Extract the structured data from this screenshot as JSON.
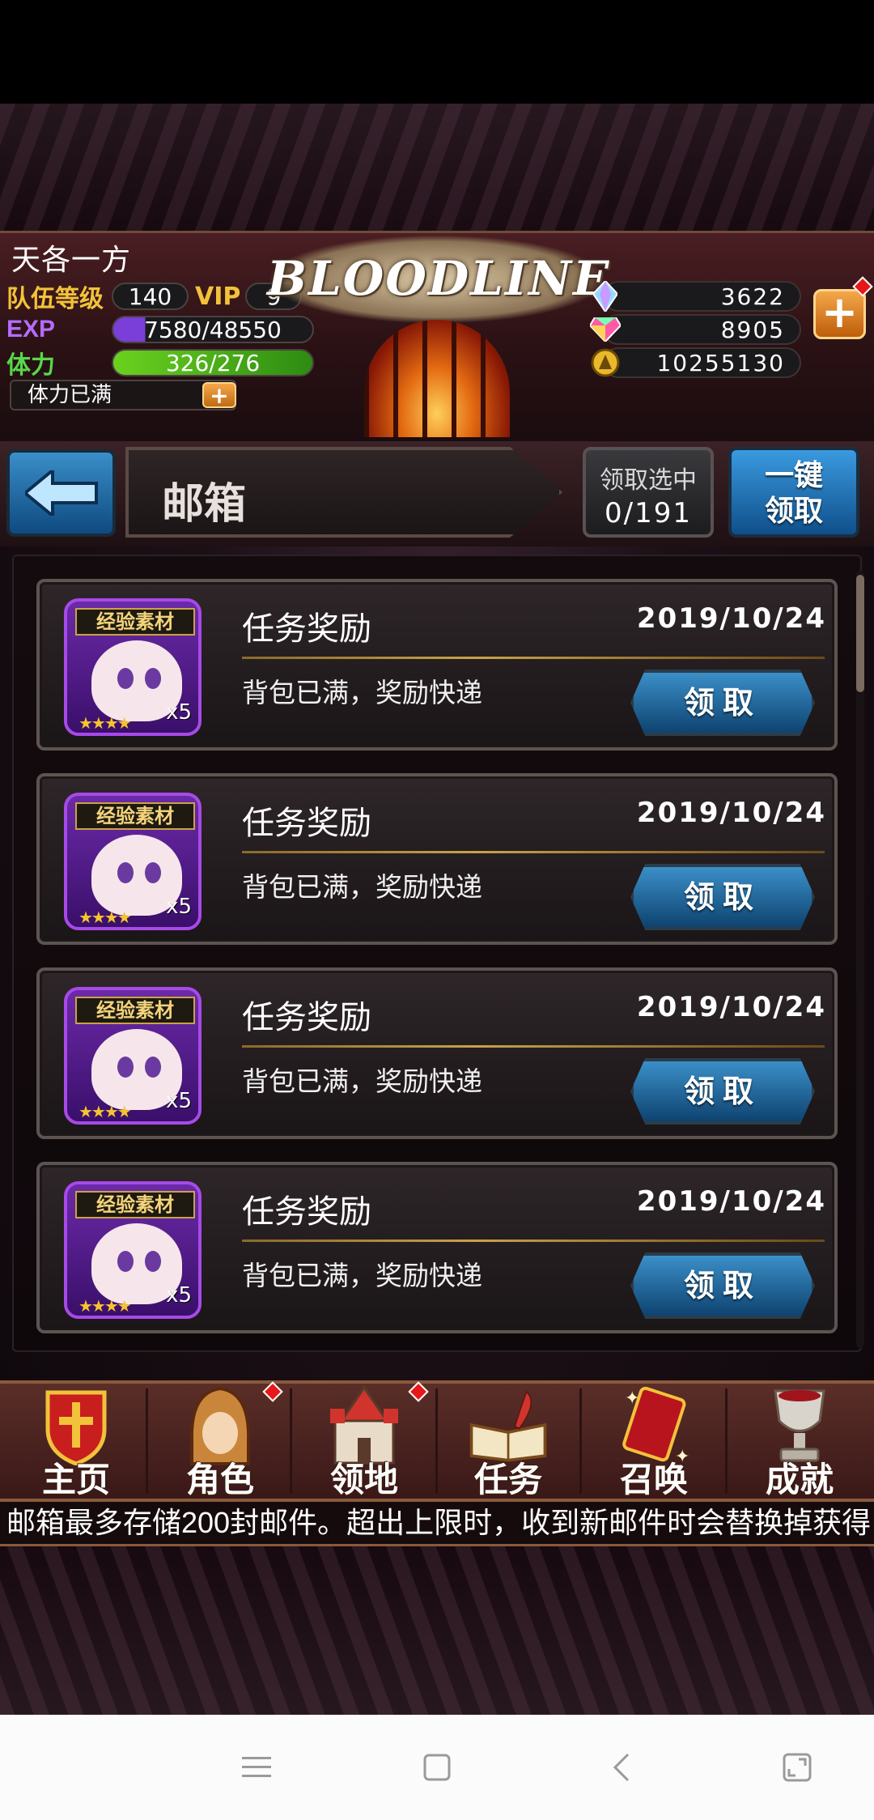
{
  "player": {
    "name": "天各一方",
    "level_label": "队伍等级",
    "level": "140",
    "vip_label": "VIP",
    "vip": "9",
    "exp_label": "EXP",
    "exp": "7580/48550",
    "exp_fraction": 0.156,
    "stamina_label": "体力",
    "stamina": "326/276",
    "stamina_full_text": "体力已满"
  },
  "logo": {
    "text": "BLOODLINE"
  },
  "currencies": [
    {
      "icon": "crystal-icon",
      "value": "3622"
    },
    {
      "icon": "gem-icon",
      "value": "8905"
    },
    {
      "icon": "gold-coin-icon",
      "value": "10255130"
    }
  ],
  "titlebar": {
    "title": "邮箱",
    "select_label": "领取选中",
    "select_count": "0/191",
    "claim_all": "一键领取"
  },
  "mails": [
    {
      "item_tag": "经验素材",
      "quantity": "x5",
      "stars": 4,
      "title": "任务奖励",
      "date": "2019/10/24",
      "description": "背包已满，奖励快递",
      "claim_label": "领取"
    },
    {
      "item_tag": "经验素材",
      "quantity": "x5",
      "stars": 4,
      "title": "任务奖励",
      "date": "2019/10/24",
      "description": "背包已满，奖励快递",
      "claim_label": "领取"
    },
    {
      "item_tag": "经验素材",
      "quantity": "x5",
      "stars": 4,
      "title": "任务奖励",
      "date": "2019/10/24",
      "description": "背包已满，奖励快递",
      "claim_label": "领取"
    },
    {
      "item_tag": "经验素材",
      "quantity": "x5",
      "stars": 4,
      "title": "任务奖励",
      "date": "2019/10/24",
      "description": "背包已满，奖励快递",
      "claim_label": "领取"
    }
  ],
  "nav": [
    {
      "label": "主页",
      "icon": "home-shield-icon"
    },
    {
      "label": "角色",
      "icon": "hooded-character-icon"
    },
    {
      "label": "领地",
      "icon": "castle-icon"
    },
    {
      "label": "任务",
      "icon": "quest-book-icon"
    },
    {
      "label": "召唤",
      "icon": "summon-card-icon"
    },
    {
      "label": "成就",
      "icon": "trophy-icon"
    }
  ],
  "marquee": "邮箱最多存储200封邮件。超出上限时，收到新邮件时会替换掉获得",
  "colors": {
    "accent_blue": "#1f6fb0",
    "gold": "#f2c23a",
    "alert_red": "#e81818"
  }
}
